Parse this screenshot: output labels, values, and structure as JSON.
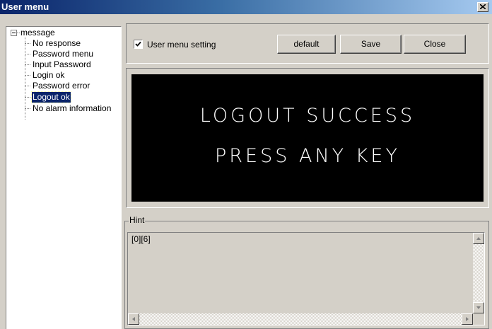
{
  "window": {
    "title": "User menu"
  },
  "tree": {
    "root": "message",
    "items": [
      {
        "label": "No response"
      },
      {
        "label": "Password menu"
      },
      {
        "label": "Input Password"
      },
      {
        "label": "Login ok"
      },
      {
        "label": "Password error"
      },
      {
        "label": "Logout ok",
        "selected": true
      },
      {
        "label": "No alarm information"
      }
    ]
  },
  "toolbar": {
    "checkbox_label": "User menu setting",
    "checkbox_checked": true,
    "default_label": "default",
    "save_label": "Save",
    "close_label": "Close"
  },
  "display": {
    "line1": "LOGOUT SUCCESS",
    "line2": "PRESS ANY KEY",
    "background": "#000000",
    "foreground": "#ffffff"
  },
  "hint": {
    "label": "Hint",
    "text": "[0][6]"
  },
  "colors": {
    "title_bar": "#0a246a",
    "selection": "#0a246a",
    "face": "#d4d0c8"
  }
}
